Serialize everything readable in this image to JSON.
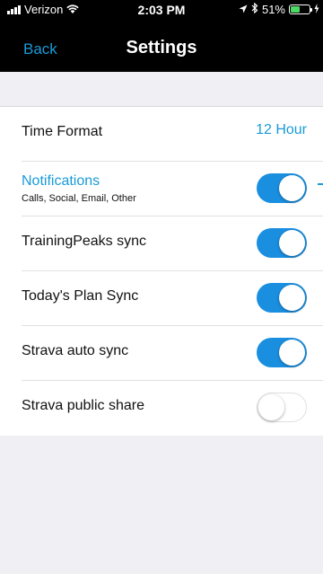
{
  "status_bar": {
    "carrier": "Verizon",
    "time": "2:03 PM",
    "battery_percent": "51%",
    "battery_level": 0.51,
    "icons": [
      "signal-bars-icon",
      "wifi-icon",
      "location-arrow-icon",
      "bluetooth-icon",
      "battery-icon",
      "charging-bolt-icon"
    ]
  },
  "nav": {
    "back_label": "Back",
    "title": "Settings"
  },
  "settings": {
    "time_format": {
      "label": "Time Format",
      "value": "12 Hour"
    },
    "notifications": {
      "label": "Notifications",
      "subtitle": "Calls, Social, Email, Other",
      "enabled": true
    },
    "trainingpeaks_sync": {
      "label": "TrainingPeaks sync",
      "enabled": true
    },
    "todays_plan_sync": {
      "label": "Today's Plan Sync",
      "enabled": true
    },
    "strava_auto_sync": {
      "label": "Strava auto sync",
      "enabled": true
    },
    "strava_public_share": {
      "label": "Strava public share",
      "enabled": false
    }
  },
  "colors": {
    "accent": "#1a9bd7",
    "toggle_on": "#1a8fe0",
    "background": "#efeff4"
  }
}
